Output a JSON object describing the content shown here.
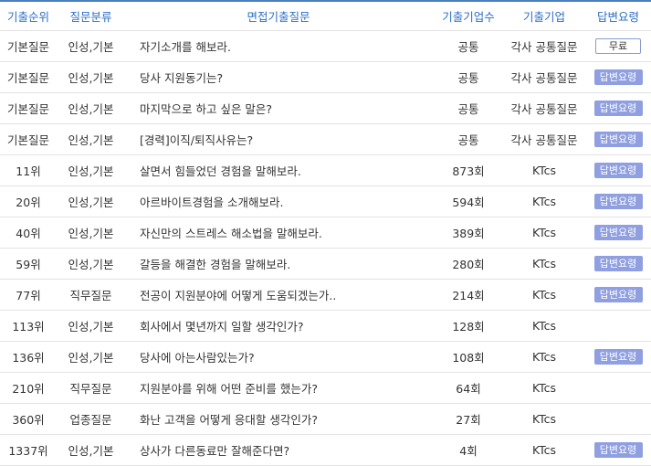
{
  "header": {
    "rank": "기출순위",
    "category": "질문분류",
    "question": "면접기출질문",
    "count": "기출기업수",
    "company": "기출기업",
    "answer": "답변요령"
  },
  "free_label": "무료",
  "answer_label": "답변요령",
  "rows": [
    {
      "rank": "기본질문",
      "category": "인성,기본",
      "question": "자기소개를 해보라.",
      "count": "공통",
      "company": "각사 공통질문",
      "answer": "free"
    },
    {
      "rank": "기본질문",
      "category": "인성,기본",
      "question": "당사 지원동기는?",
      "count": "공통",
      "company": "각사 공통질문",
      "answer": "guide"
    },
    {
      "rank": "기본질문",
      "category": "인성,기본",
      "question": "마지막으로 하고 싶은 말은?",
      "count": "공통",
      "company": "각사 공통질문",
      "answer": "guide"
    },
    {
      "rank": "기본질문",
      "category": "인성,기본",
      "question": "[경력]이직/퇴직사유는?",
      "count": "공통",
      "company": "각사 공통질문",
      "answer": "guide"
    },
    {
      "rank": "11위",
      "category": "인성,기본",
      "question": "살면서 힘들었던 경험을 말해보라.",
      "count": "873회",
      "company": "KTcs",
      "answer": "guide"
    },
    {
      "rank": "20위",
      "category": "인성,기본",
      "question": "아르바이트경험을 소개해보라.",
      "count": "594회",
      "company": "KTcs",
      "answer": "guide"
    },
    {
      "rank": "40위",
      "category": "인성,기본",
      "question": "자신만의 스트레스 해소법을 말해보라.",
      "count": "389회",
      "company": "KTcs",
      "answer": "guide"
    },
    {
      "rank": "59위",
      "category": "인성,기본",
      "question": "갈등을 해결한 경험을 말해보라.",
      "count": "280회",
      "company": "KTcs",
      "answer": "guide"
    },
    {
      "rank": "77위",
      "category": "직무질문",
      "question": "전공이 지원분야에 어떻게 도움되겠는가..",
      "count": "214회",
      "company": "KTcs",
      "answer": "guide"
    },
    {
      "rank": "113위",
      "category": "인성,기본",
      "question": "회사에서 몇년까지 일할 생각인가?",
      "count": "128회",
      "company": "KTcs",
      "answer": ""
    },
    {
      "rank": "136위",
      "category": "인성,기본",
      "question": "당사에 아는사람있는가?",
      "count": "108회",
      "company": "KTcs",
      "answer": "guide"
    },
    {
      "rank": "210위",
      "category": "직무질문",
      "question": "지원분야를 위해 어떤 준비를 했는가?",
      "count": "64회",
      "company": "KTcs",
      "answer": ""
    },
    {
      "rank": "360위",
      "category": "업종질문",
      "question": "화난 고객을 어떻게 응대할 생각인가?",
      "count": "27회",
      "company": "KTcs",
      "answer": ""
    },
    {
      "rank": "1337위",
      "category": "인성,기본",
      "question": "상사가 다른동료만 잘해준다면?",
      "count": "4회",
      "company": "KTcs",
      "answer": "guide"
    }
  ]
}
